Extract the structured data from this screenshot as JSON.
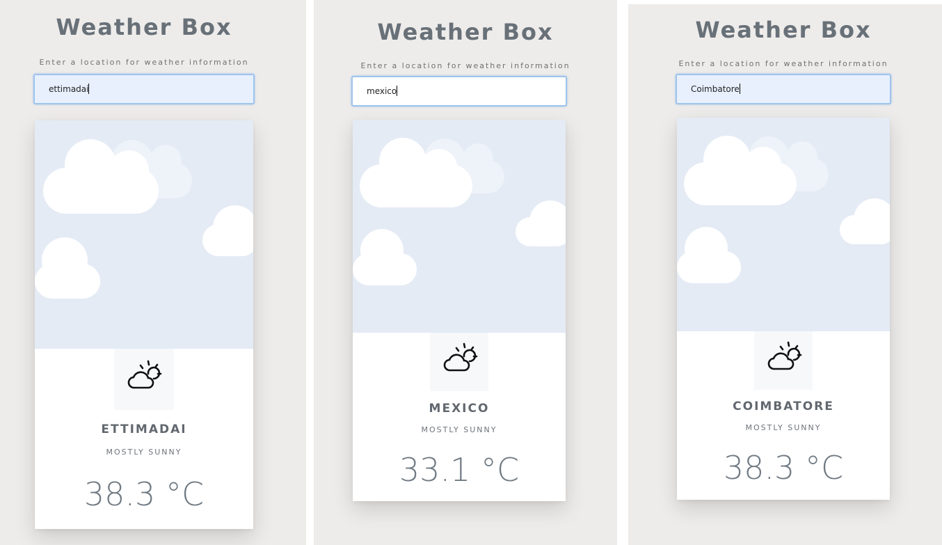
{
  "app": {
    "title": "Weather Box",
    "search_hint": "Enter a location for weather information"
  },
  "colors": {
    "panel_bg": "#eeecea",
    "sky": "#e4ebf5",
    "title": "#687078",
    "input_focus_border": "#9ec4ec"
  },
  "panels": [
    {
      "search_value": "ettimadai",
      "city": "ETTIMADAI",
      "condition": "MOSTLY SUNNY",
      "temperature": "38.3 °C",
      "icon": "partly-sunny-icon"
    },
    {
      "search_value": "mexico",
      "city": "MEXICO",
      "condition": "MOSTLY SUNNY",
      "temperature": "33.1 °C",
      "icon": "partly-sunny-icon"
    },
    {
      "search_value": "Coimbatore",
      "city": "COIMBATORE",
      "condition": "MOSTLY SUNNY",
      "temperature": "38.3 °C",
      "icon": "partly-sunny-icon"
    }
  ]
}
